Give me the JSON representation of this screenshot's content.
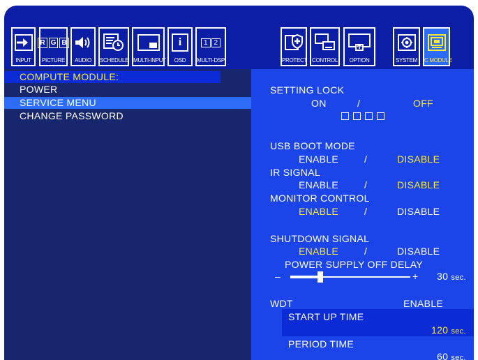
{
  "toolbar": {
    "items": [
      {
        "label": "INPUT",
        "icon": "input-icon"
      },
      {
        "label": "PICTURE",
        "icon": "rgb-icon"
      },
      {
        "label": "AUDIO",
        "icon": "speaker-icon"
      },
      {
        "label": "SCHEDULE",
        "icon": "schedule-icon"
      },
      {
        "label": "MULTI-INPUT",
        "icon": "multi-input-icon"
      },
      {
        "label": "OSD",
        "icon": "info-icon"
      },
      {
        "label": "MULTI-DSP",
        "icon": "multi-display-icon"
      },
      {
        "label": "PROTECT",
        "icon": "shield-icon"
      },
      {
        "label": "CONTROL",
        "icon": "control-icon"
      },
      {
        "label": "OPTION",
        "icon": "option-icon"
      },
      {
        "label": "SYSTEM",
        "icon": "gear-icon"
      },
      {
        "label": "C MODULE",
        "icon": "compute-module-icon"
      }
    ],
    "rgb": [
      "R",
      "G",
      "B"
    ],
    "osd_glyph": "i",
    "multi_dsp_digits": [
      "1",
      "2"
    ]
  },
  "menu": {
    "title": "COMPUTE MODULE:",
    "items": [
      "POWER",
      "SERVICE MENU",
      "CHANGE PASSWORD"
    ]
  },
  "settings": {
    "setting_lock": {
      "label": "SETTING LOCK",
      "on": "ON",
      "slash": "/",
      "off": "OFF"
    },
    "usb_boot_mode": {
      "label": "USB BOOT MODE",
      "enable": "ENABLE",
      "slash": "/",
      "disable": "DISABLE"
    },
    "ir_signal": {
      "label": "IR SIGNAL",
      "enable": "ENABLE",
      "slash": "/",
      "disable": "DISABLE"
    },
    "monitor_control": {
      "label": "MONITOR CONTROL",
      "enable": "ENABLE",
      "slash": "/",
      "disable": "DISABLE"
    },
    "shutdown_signal": {
      "label": "SHUTDOWN SIGNAL",
      "enable": "ENABLE",
      "slash": "/",
      "disable": "DISABLE"
    },
    "power_supply_off_delay": {
      "label": "POWER SUPPLY OFF DELAY",
      "minus": "–",
      "plus": "+",
      "value": "30",
      "unit": "sec.",
      "slider_level": 0.25
    },
    "wdt": {
      "label": "WDT",
      "value": "ENABLE"
    },
    "start_up_time": {
      "label": "START UP TIME",
      "value": "120",
      "unit": "sec."
    },
    "period_time": {
      "label": "PERIOD TIME",
      "value": "60",
      "unit": "sec."
    }
  },
  "colors": {
    "background": "#0d1ea6",
    "selected": "#2d6cf7",
    "highlight": "#ffe934",
    "left_panel": "#18266e",
    "right_panel": "#1b45e8"
  }
}
